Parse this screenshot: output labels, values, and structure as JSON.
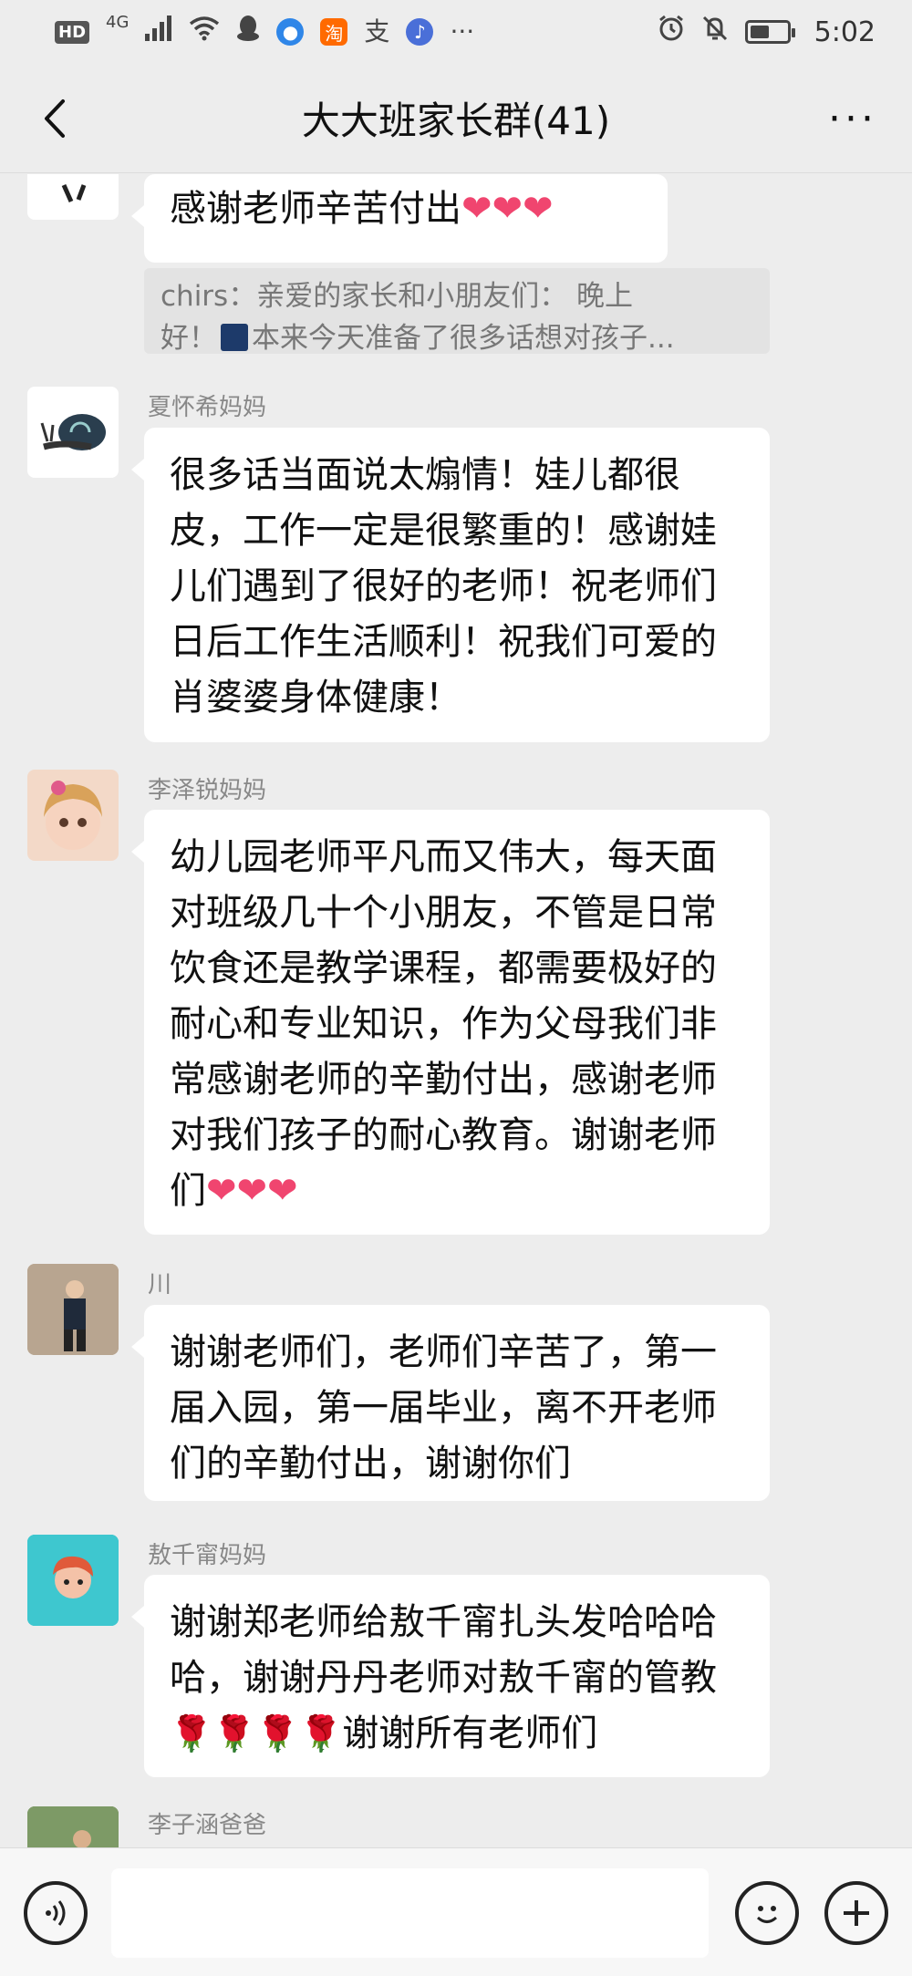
{
  "status_bar": {
    "hd_label": "HD",
    "network": "4G",
    "alipay_char": "支",
    "taobao_char": "淘",
    "more_glyph": "···",
    "time": "5:02"
  },
  "header": {
    "title": "大大班家长群(41)",
    "more_glyph": "···"
  },
  "messages": [
    {
      "text": "感谢老师辛苦付出",
      "hearts": "❤❤❤"
    },
    {
      "quote_line1": "chirs：亲爱的家长和小朋友们：     晚上",
      "quote_line2": "好！",
      "quote_line2_rest": "本来今天准备了很多话想对孩子..."
    },
    {
      "sender": "夏怀希妈妈",
      "text": "很多话当面说太煽情！娃儿都很皮，工作一定是很繁重的！感谢娃儿们遇到了很好的老师！祝老师们日后工作生活顺利！祝我们可爱的肖婆婆身体健康！"
    },
    {
      "sender": "李泽锐妈妈",
      "text": "幼儿园老师平凡而又伟大，每天面对班级几十个小朋友，不管是日常饮食还是教学课程，都需要极好的耐心和专业知识，作为父母我们非常感谢老师的辛勤付出，感谢老师对我们孩子的耐心教育。谢谢老师们",
      "hearts": "❤❤❤"
    },
    {
      "sender": "川",
      "text": "谢谢老师们，老师们辛苦了，第一届入园，第一届毕业，离不开老师们的辛勤付出，谢谢你们"
    },
    {
      "sender": "敖千甯妈妈",
      "text": "谢谢郑老师给敖千甯扎头发哈哈哈哈，谢谢丹丹老师对敖千甯的管教",
      "roses": "🌹🌹🌹🌹",
      "text_after": "谢谢所有老师们"
    },
    {
      "sender": "李子涵爸爸"
    }
  ],
  "input_bar": {
    "placeholder": ""
  }
}
